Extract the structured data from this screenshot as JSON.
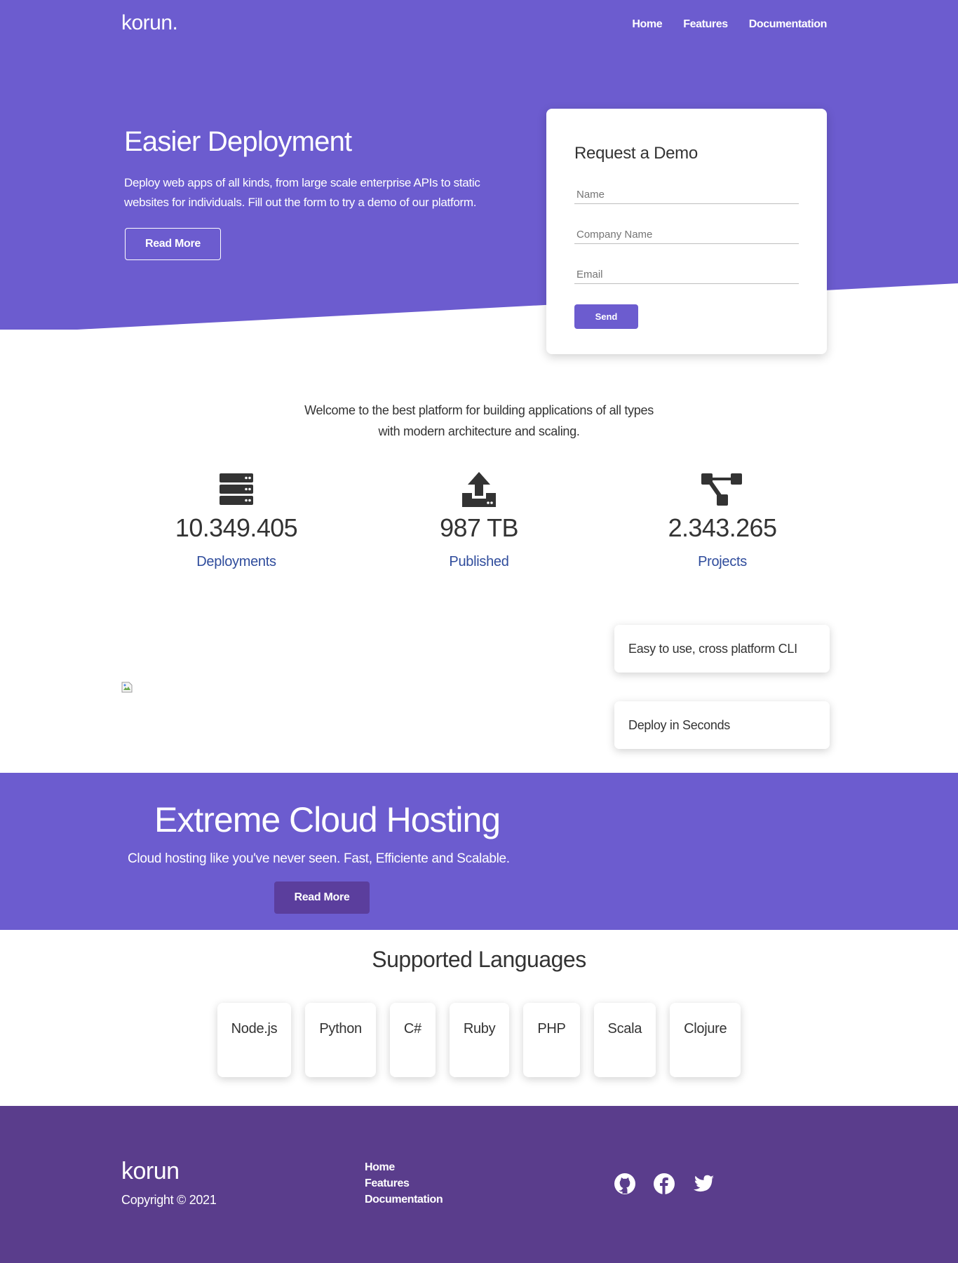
{
  "brand": "korun.",
  "nav": [
    "Home",
    "Features",
    "Documentation"
  ],
  "hero": {
    "title": "Easier Deployment",
    "text": "Deploy web apps of all kinds, from large scale enterprise APIs to static websites for individuals. Fill out the form to try a demo of our platform.",
    "button": "Read More"
  },
  "demo_form": {
    "title": "Request a Demo",
    "name_placeholder": "Name",
    "company_placeholder": "Company Name",
    "email_placeholder": "Email",
    "send": "Send"
  },
  "welcome": "Welcome to the best platform for building applications of all types with modern architecture and scaling.",
  "stats": [
    {
      "icon": "server-icon",
      "value": "10.349.405",
      "label": "Deployments"
    },
    {
      "icon": "upload-icon",
      "value": "987 TB",
      "label": "Published"
    },
    {
      "icon": "sitemap-icon",
      "value": "2.343.265",
      "label": "Projects"
    }
  ],
  "features": [
    "Easy to use, cross platform CLI",
    "Deploy in Seconds"
  ],
  "cloud": {
    "title": "Extreme Cloud Hosting",
    "text": "Cloud hosting like you've never seen. Fast, Efficiente and Scalable.",
    "button": "Read More"
  },
  "languages": {
    "title": "Supported Languages",
    "items": [
      "Node.js",
      "Python",
      "C#",
      "Ruby",
      "PHP",
      "Scala",
      "Clojure"
    ]
  },
  "footer": {
    "brand": "korun",
    "copyright": "Copyright © 2021",
    "links": [
      "Home",
      "Features",
      "Documentation"
    ],
    "socials": [
      "github-icon",
      "facebook-icon",
      "twitter-icon"
    ]
  },
  "colors": {
    "primary": "#6c5ccf",
    "footer": "#5a3d8c",
    "button_dark": "#5b3e9d",
    "stat_label": "#2f4c9c"
  }
}
